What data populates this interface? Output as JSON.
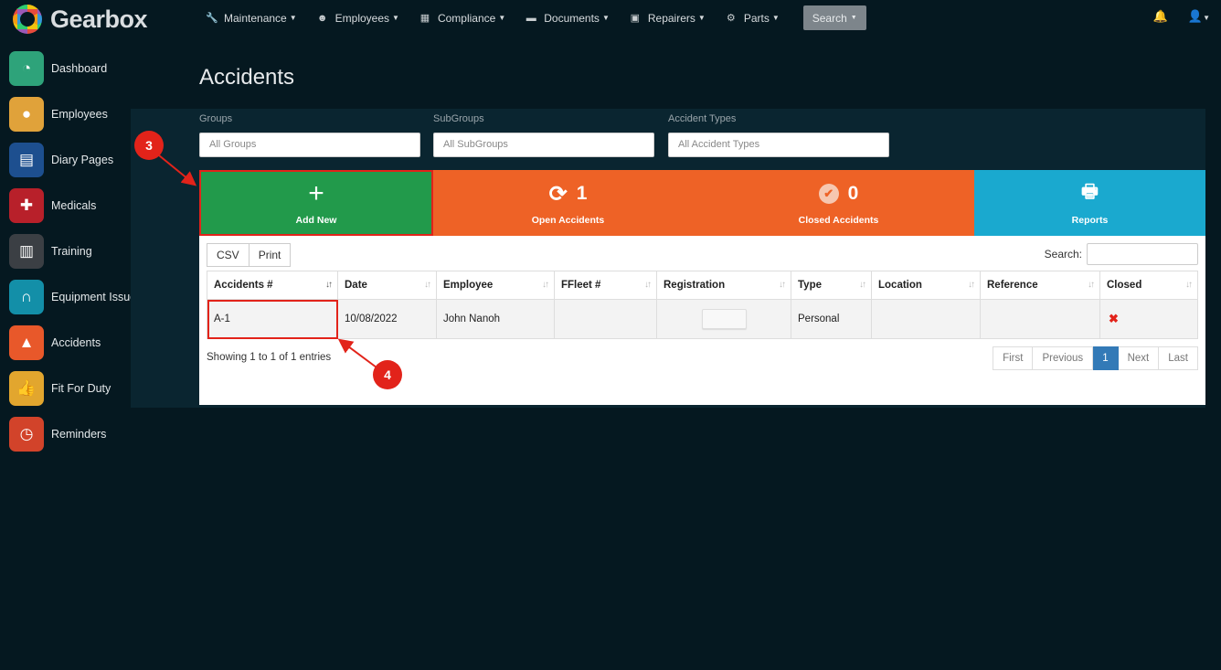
{
  "app": {
    "name": "Gearbox"
  },
  "nav": {
    "items": [
      {
        "label": "Maintenance",
        "icon": "wrench-icon",
        "glyph": "🔧"
      },
      {
        "label": "Employees",
        "icon": "user-circle-icon",
        "glyph": "☻"
      },
      {
        "label": "Compliance",
        "icon": "calendar-icon",
        "glyph": "▦"
      },
      {
        "label": "Documents",
        "icon": "folder-icon",
        "glyph": "▬"
      },
      {
        "label": "Repairers",
        "icon": "id-card-icon",
        "glyph": "▣"
      },
      {
        "label": "Parts",
        "icon": "gear-icon",
        "glyph": "⚙"
      }
    ],
    "search_label": "Search"
  },
  "sidebar": {
    "items": [
      {
        "label": "Dashboard",
        "icon": "speedometer-icon",
        "glyph": "◔",
        "color": "#2ea37a"
      },
      {
        "label": "Employees",
        "icon": "user-icon",
        "glyph": "●",
        "color": "#e0a23a"
      },
      {
        "label": "Diary Pages",
        "icon": "document-icon",
        "glyph": "▤",
        "color": "#1d4f8f"
      },
      {
        "label": "Medicals",
        "icon": "medical-kit-icon",
        "glyph": "✚",
        "color": "#b8202a"
      },
      {
        "label": "Training",
        "icon": "id-badge-icon",
        "glyph": "▥",
        "color": "#3b3f44"
      },
      {
        "label": "Equipment Issue",
        "icon": "headphones-icon",
        "glyph": "∩",
        "color": "#138fa8"
      },
      {
        "label": "Accidents",
        "icon": "warning-icon",
        "glyph": "▲",
        "color": "#e8582a"
      },
      {
        "label": "Fit For Duty",
        "icon": "thumbs-up-icon",
        "glyph": "👍",
        "color": "#e2a62e"
      },
      {
        "label": "Reminders",
        "icon": "alarm-clock-icon",
        "glyph": "◷",
        "color": "#d2432a"
      }
    ]
  },
  "page": {
    "title": "Accidents"
  },
  "filters": [
    {
      "label": "Groups",
      "placeholder": "All Groups"
    },
    {
      "label": "SubGroups",
      "placeholder": "All SubGroups"
    },
    {
      "label": "Accident Types",
      "placeholder": "All Accident Types"
    }
  ],
  "tiles": {
    "add": {
      "label": "Add New"
    },
    "open": {
      "count": "1",
      "label": "Open Accidents"
    },
    "closed": {
      "count": "0",
      "label": "Closed Accidents"
    },
    "reports": {
      "label": "Reports"
    }
  },
  "table": {
    "buttons": {
      "csv": "CSV",
      "print": "Print"
    },
    "search_label": "Search:",
    "columns": [
      "Accidents #",
      "Date",
      "Employee",
      "FFleet #",
      "Registration",
      "Type",
      "Location",
      "Reference",
      "Closed"
    ],
    "rows": [
      {
        "accident": "A-1",
        "date": "10/08/2022",
        "employee": "John Nanoh",
        "fleet": "",
        "registration": "",
        "type": "Personal",
        "location": "",
        "reference": "",
        "closed": "✖"
      }
    ],
    "info": "Showing 1 to 1 of 1 entries",
    "pager": {
      "first": "First",
      "previous": "Previous",
      "current": "1",
      "next": "Next",
      "last": "Last"
    }
  },
  "annotations": {
    "step3": "3",
    "step4": "4",
    "color": "#e2231a"
  }
}
